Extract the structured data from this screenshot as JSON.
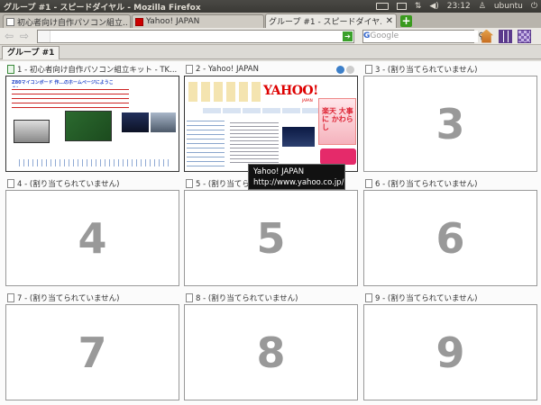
{
  "window": {
    "title": "グループ #1 - スピードダイヤル - Mozilla Firefox"
  },
  "panel": {
    "time": "23:12",
    "user": "ubuntu"
  },
  "tabs": [
    {
      "label": "初心者向け自作パソコン組立...",
      "favicon": "doc"
    },
    {
      "label": "Yahoo! JAPAN",
      "favicon": "yahoo"
    },
    {
      "label": "グループ #1 - スピードダイヤル",
      "favicon": "grid",
      "active": true
    }
  ],
  "navbar": {
    "url_value": "",
    "search_engine": "G",
    "search_placeholder": "Google"
  },
  "group": {
    "label": "グループ #1"
  },
  "cells": [
    {
      "label": "1 - 初心者向け自作パソコン組立キット - TK...",
      "thumb_text": "Z80マイコンボード 作...のホームページにようこそ!"
    },
    {
      "label": "2 - Yahoo! JAPAN",
      "logo": "YAHOO!",
      "logo_sub": "JAPAN",
      "ad_text": "楽天 大事に かわらし"
    },
    {
      "label": "3 - (割り当てられていません)",
      "number": "3"
    },
    {
      "label": "4 - (割り当てられていません)",
      "number": "4"
    },
    {
      "label": "5 - (割り当てられていません)",
      "number": "5"
    },
    {
      "label": "6 - (割り当てられていません)",
      "number": "6"
    },
    {
      "label": "7 - (割り当てられていません)",
      "number": "7"
    },
    {
      "label": "8 - (割り当てられていません)",
      "number": "8"
    },
    {
      "label": "9 - (割り当てられていません)",
      "number": "9"
    }
  ],
  "tooltip": {
    "title": "Yahoo! JAPAN",
    "url": "http://www.yahoo.co.jp/"
  }
}
